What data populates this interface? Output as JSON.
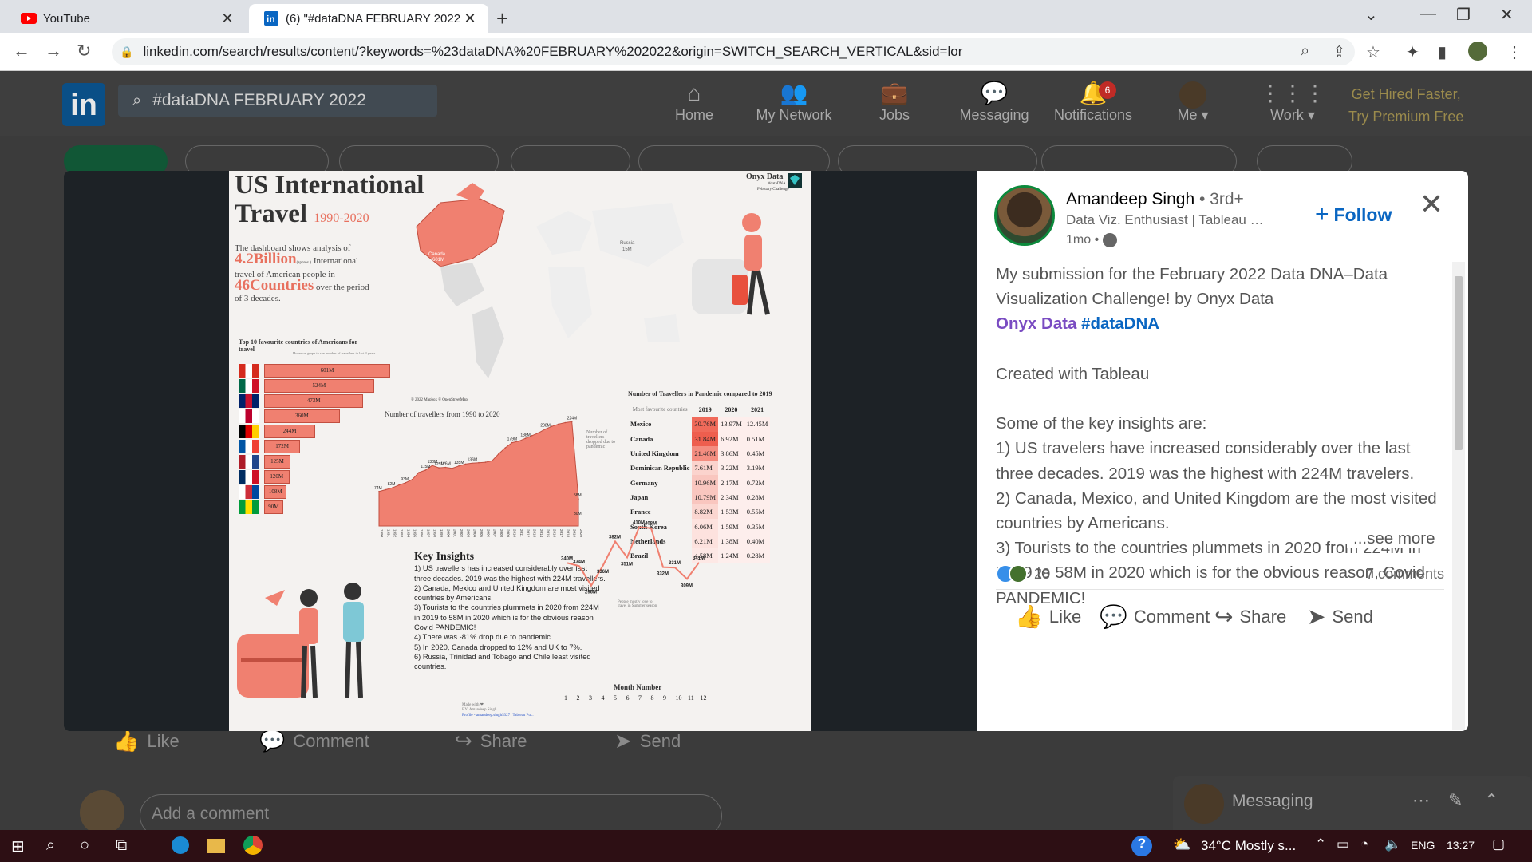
{
  "browser": {
    "tabs": [
      {
        "title": "YouTube",
        "active": false
      },
      {
        "title": "(6) \"#dataDNA FEBRUARY 2022\"",
        "active": true
      }
    ],
    "url": "linkedin.com/search/results/content/?keywords=%23dataDNA%20FEBRUARY%202022&origin=SWITCH_SEARCH_VERTICAL&sid=lor"
  },
  "linkedin": {
    "logo": "in",
    "search_value": "#dataDNA FEBRUARY 2022",
    "nav": [
      {
        "label": "Home",
        "icon": "home-icon"
      },
      {
        "label": "My Network",
        "icon": "network-icon"
      },
      {
        "label": "Jobs",
        "icon": "briefcase-icon"
      },
      {
        "label": "Messaging",
        "icon": "chat-icon"
      },
      {
        "label": "Notifications",
        "icon": "bell-icon",
        "badge": "6"
      },
      {
        "label": "Me",
        "icon": "avatar"
      },
      {
        "label": "Work",
        "icon": "grid-icon"
      }
    ],
    "premium_line1": "Get Hired Faster,",
    "premium_line2": "Try Premium Free",
    "feed_actions": [
      "Like",
      "Comment",
      "Share",
      "Send"
    ],
    "add_comment_placeholder": "Add a comment",
    "messaging_label": "Messaging"
  },
  "post": {
    "author": {
      "name": "Amandeep Singh",
      "degree": " • 3rd+",
      "headline": "Data Viz. Enthusiast | Tableau | SQL | Python",
      "time": "1mo • "
    },
    "follow_label": "Follow",
    "paragraph1": "My submission for the February 2022 Data DNA–Data Visualization Challenge! by Onyx Data",
    "mention": "Onyx Data",
    "hashtag": "#dataDNA",
    "paragraph2": "Created with Tableau",
    "insights_intro": "Some of the key insights are:",
    "insights": [
      "1) US travelers have increased considerably over the last three decades. 2019 was the highest with 224M travelers.",
      "2) Canada, Mexico, and United Kingdom are the most visited countries by Americans.",
      "3) Tourists to the countries plummets in 2020 from 224M in 2019 to 58M in 2020 which is for the obvious reason, Covid PANDEMIC!"
    ],
    "see_more": "...see more",
    "reactions_count": "28",
    "comments_count": "7 comments",
    "actions": [
      "Like",
      "Comment",
      "Share",
      "Send"
    ]
  },
  "infographic": {
    "title_line1": "US International",
    "title_line2": "Travel",
    "title_years": "1990-2020",
    "brand": "Onyx Data",
    "brand_sub1": "#dataDNA",
    "brand_sub2": "February Challenge",
    "intro_a": "The dashboard shows analysis of",
    "intro_big1": "4.2Billion",
    "intro_approx": "(approx.)",
    "intro_b": " International travel of American people in",
    "intro_big2": "46Countries",
    "intro_c": " over the period of 3 decades.",
    "map_canada": "Canada",
    "map_canada_val": "601M",
    "map_russia": "Russia",
    "map_russia_val": "15M",
    "map_credit": "© 2022 Mapbox © OpenStreetMap",
    "top10_title": "Top 10 favourite countries of Americans for travel",
    "top10_hint": "Hover on graph to see number of travellers in last 3 years",
    "top10": [
      {
        "value": 601,
        "label": "601M"
      },
      {
        "value": 524,
        "label": "524M"
      },
      {
        "value": 473,
        "label": "473M"
      },
      {
        "value": 360,
        "label": "360M"
      },
      {
        "value": 244,
        "label": "244M"
      },
      {
        "value": 172,
        "label": "172M"
      },
      {
        "value": 125,
        "label": "125M"
      },
      {
        "value": 120,
        "label": "120M"
      },
      {
        "value": 108,
        "label": "108M"
      },
      {
        "value": 90,
        "label": "90M"
      }
    ],
    "area_title": "Number of travellers from 1990 to 2020",
    "area_note": "Number of travellers dropped due to pandemic",
    "area_labels": [
      "74M",
      "82M",
      "93M",
      "115M",
      "130M",
      "125M",
      "126M",
      "135M",
      "136M",
      "179M",
      "188M",
      "208M",
      "224M",
      "58M",
      "30M"
    ],
    "years": [
      "1990",
      "1991",
      "1992",
      "1993",
      "1994",
      "1995",
      "1996",
      "1997",
      "1998",
      "1999",
      "2000",
      "2001",
      "2002",
      "2003",
      "2004",
      "2005",
      "2006",
      "2007",
      "2008",
      "2009",
      "2010",
      "2011",
      "2012",
      "2013",
      "2014",
      "2015",
      "2016",
      "2017",
      "2018",
      "2019",
      "2020"
    ],
    "table_title": "Number of Travellers in Pandemic compared to 2019",
    "table_header": [
      "Most favourite countries",
      "2019",
      "2020",
      "2021"
    ],
    "table_rows": [
      [
        "Mexico",
        "30.76M",
        "13.97M",
        "12.45M"
      ],
      [
        "Canada",
        "31.84M",
        "6.92M",
        "0.51M"
      ],
      [
        "United Kingdom",
        "21.46M",
        "3.86M",
        "0.45M"
      ],
      [
        "Dominican Republic",
        "7.61M",
        "3.22M",
        "3.19M"
      ],
      [
        "Germany",
        "10.96M",
        "2.17M",
        "0.72M"
      ],
      [
        "Japan",
        "10.79M",
        "2.34M",
        "0.28M"
      ],
      [
        "France",
        "8.82M",
        "1.53M",
        "0.55M"
      ],
      [
        "South Korea",
        "6.06M",
        "1.59M",
        "0.35M"
      ],
      [
        "Netherlands",
        "6.21M",
        "1.38M",
        "0.40M"
      ],
      [
        "Brazil",
        "4.58M",
        "1.24M",
        "0.28M"
      ]
    ],
    "insights_title": "Key Insights",
    "insights": [
      "1) US travellers has increased considerably over last three decades. 2019 was the highest with 224M travellers.",
      "2) Canada, Mexico and United Kingdom are most visited countries by Americans.",
      "3) Tourists to the countries plummets in 2020 from 224M in 2019 to 58M in 2020 which is for the obvious reason Covid PANDEMIC!",
      "4) There was -81% drop due to pandemic.",
      "5) In 2020, Canada dropped to 12% and UK to 7%.",
      "6) Russia, Trinidad and Tobago and Chile least visited countries."
    ],
    "month_title": "Month Number",
    "month_labels": [
      "340M",
      "334M",
      "296M",
      "336M",
      "382M",
      "351M",
      "410M",
      "408M",
      "332M",
      "331M",
      "309M",
      "341M"
    ],
    "month_note": "People mostly love to travel in Summer season",
    "months": [
      "1",
      "2",
      "3",
      "4",
      "5",
      "6",
      "7",
      "8",
      "9",
      "10",
      "11",
      "12"
    ],
    "credit1": "Made with ❤",
    "credit2": "BY: Amandeep Singh",
    "credit3": "Profile - amandeep.singh5327 | Tableau Pu..."
  },
  "chart_data": [
    {
      "type": "bar",
      "title": "Top 10 favourite countries of Americans for travel",
      "categories": [
        "Canada",
        "Mexico",
        "United Kingdom",
        "Japan",
        "Germany",
        "France",
        "Netherlands",
        "Dominican Republic",
        "South Korea",
        "Brazil"
      ],
      "values": [
        601,
        524,
        473,
        360,
        244,
        172,
        125,
        120,
        108,
        90
      ]
    },
    {
      "type": "area",
      "title": "Number of travellers from 1990 to 2020",
      "x": [
        1990,
        1991,
        1992,
        1993,
        1994,
        1995,
        1996,
        1997,
        1998,
        1999,
        2000,
        2001,
        2002,
        2003,
        2004,
        2005,
        2006,
        2007,
        2008,
        2009,
        2010,
        2011,
        2012,
        2013,
        2014,
        2015,
        2016,
        2017,
        2018,
        2019,
        2020
      ],
      "values": [
        74,
        78,
        82,
        88,
        93,
        100,
        115,
        120,
        130,
        125,
        126,
        124,
        129,
        133,
        135,
        136,
        137,
        140,
        155,
        168,
        179,
        182,
        188,
        194,
        200,
        208,
        214,
        219,
        222,
        224,
        58
      ]
    },
    {
      "type": "line",
      "title": "Month Number",
      "x": [
        1,
        2,
        3,
        4,
        5,
        6,
        7,
        8,
        9,
        10,
        11,
        12
      ],
      "values": [
        340,
        334,
        296,
        336,
        382,
        351,
        410,
        408,
        332,
        331,
        309,
        341
      ]
    }
  ],
  "colors": {
    "accent": "#0a66c2",
    "coral": "#f08070",
    "mention": "#7a4cc2"
  },
  "taskbar": {
    "weather": "34°C  Mostly s...",
    "lang": "ENG",
    "time": "13:27"
  }
}
